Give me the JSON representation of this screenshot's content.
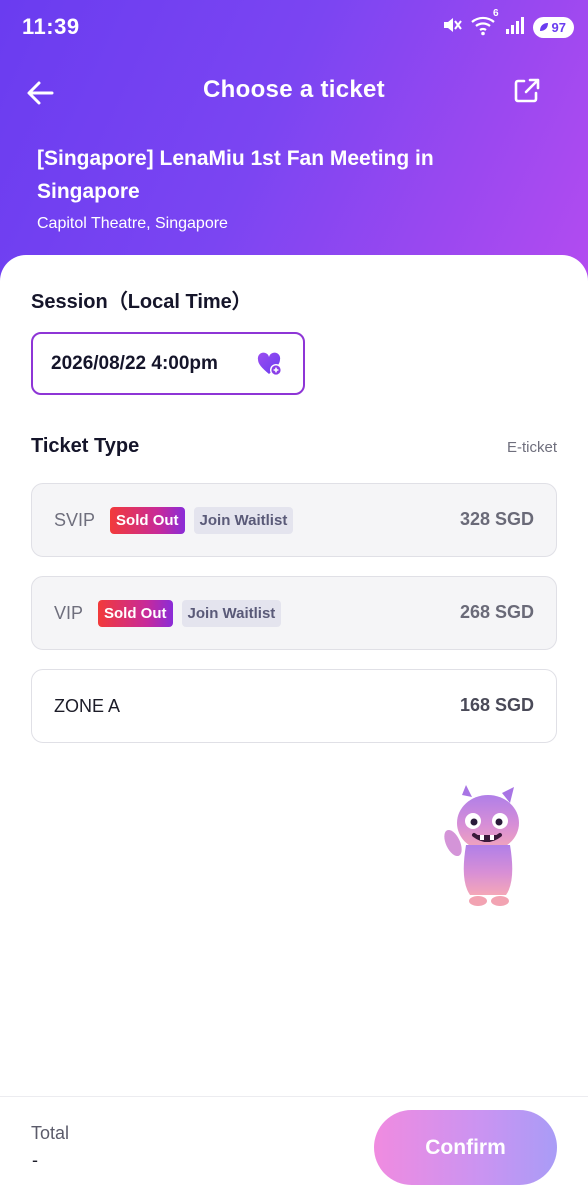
{
  "status_bar": {
    "time": "11:39",
    "battery": "97",
    "network_badge": "6"
  },
  "nav": {
    "title": "Choose a ticket"
  },
  "event": {
    "title": "[Singapore] LenaMiu 1st Fan Meeting in Singapore",
    "venue": "Capitol Theatre, Singapore"
  },
  "session": {
    "label": "Session（Local Time）",
    "selected": "2026/08/22 4:00pm"
  },
  "ticket_section": {
    "label": "Ticket Type",
    "delivery": "E-ticket"
  },
  "tickets": [
    {
      "name": "SVIP",
      "status": "Sold Out",
      "waitlist": "Join Waitlist",
      "price": "328 SGD"
    },
    {
      "name": "VIP",
      "status": "Sold Out",
      "waitlist": "Join Waitlist",
      "price": "268 SGD"
    },
    {
      "name": "ZONE A",
      "price": "168 SGD"
    }
  ],
  "footer": {
    "total_label": "Total",
    "total_value": "-",
    "confirm_label": "Confirm"
  },
  "colors": {
    "header_start": "#6a3cf0",
    "header_end": "#b44cf0",
    "accent": "#8e35d6",
    "sold_out": "#f23a3a"
  }
}
